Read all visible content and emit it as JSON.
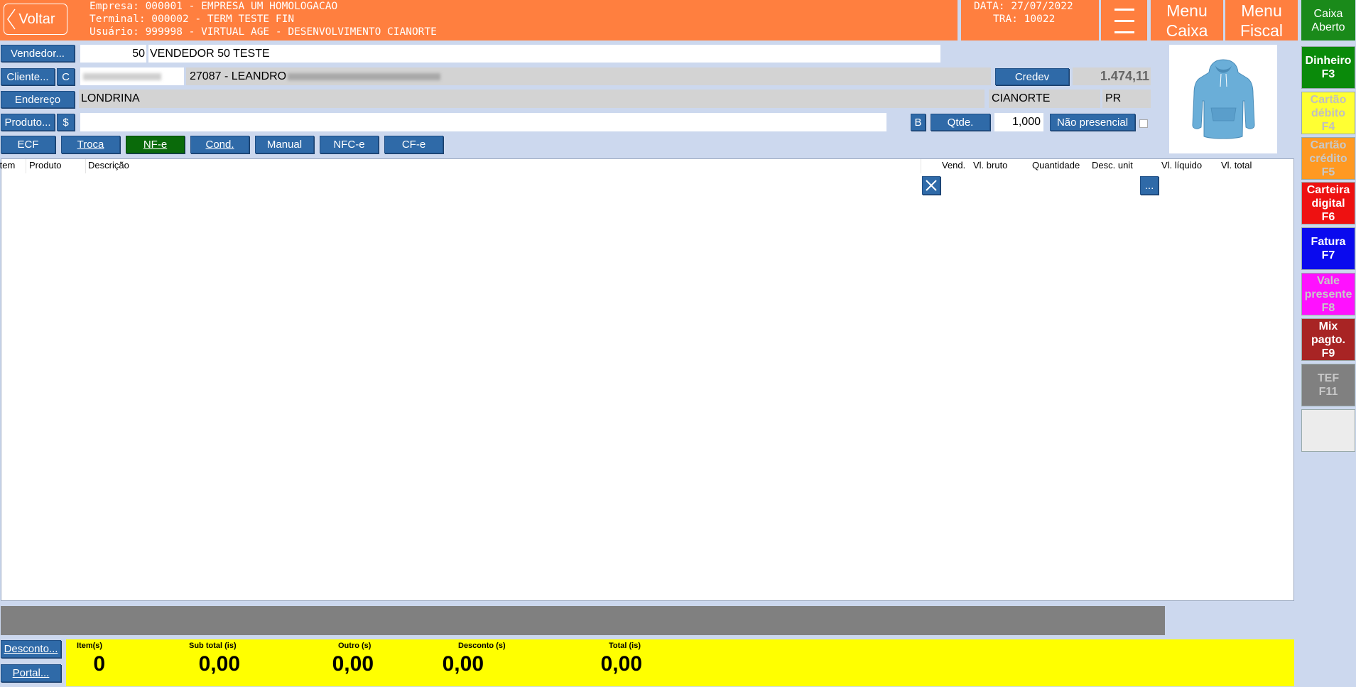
{
  "header": {
    "back_label": "Voltar",
    "empresa": "Empresa: 000001 - EMPRESA UM HOMOLOGACAO",
    "terminal": "Terminal: 000002 - TERM TESTE FIN",
    "usuario": "Usuário: 999998 - VIRTUAL AGE - DESENVOLVIMENTO CIANORTE",
    "data": "DATA: 27/07/2022",
    "tra": "TRA: 10022",
    "menu_caixa": [
      "Menu",
      "Caixa"
    ],
    "menu_fiscal": [
      "Menu",
      "Fiscal"
    ],
    "caixa_status": [
      "Caixa",
      "Aberto"
    ]
  },
  "form": {
    "vendedor_label": "Vendedor...",
    "vendedor_code": "50",
    "vendedor_name": "VENDEDOR 50 TESTE",
    "cliente_label": "Cliente...",
    "cliente_c_label": "C",
    "cliente_doc": "",
    "cliente_name": "27087 - LEANDRO",
    "credev_label": "Credev",
    "credev_value": "1.474,11",
    "endereco_label": "Endereço",
    "endereco_city": "LONDRINA",
    "endereco_city2": "CIANORTE",
    "endereco_uf": "PR",
    "produto_label": "Produto...",
    "produto_dollar_label": "$",
    "produto_value": "",
    "b_label": "B",
    "qtde_label": "Qtde.",
    "qtde_value": "1,000",
    "nao_presencial_label": "Não presencial"
  },
  "doc_types": [
    {
      "label": "ECF",
      "active": false
    },
    {
      "label": "Troca",
      "active": false
    },
    {
      "label": "NF-e",
      "active": true
    },
    {
      "label": "Cond.",
      "active": false
    },
    {
      "label": "Manual",
      "active": false
    },
    {
      "label": "NFC-e",
      "active": false
    },
    {
      "label": "CF-e",
      "active": false
    }
  ],
  "table": {
    "columns": [
      "Item",
      "Produto",
      "Descrição",
      "Vend.",
      "Vl. bruto",
      "Quantidade",
      "Desc. unit",
      "Vl. líquido",
      "Vl. total"
    ],
    "more_label": "...",
    "rows": []
  },
  "payments": [
    {
      "label": [
        "Dinheiro",
        "F3"
      ],
      "bg": "#0a8a0a",
      "fg": "#ffffff"
    },
    {
      "label": [
        "Cartão",
        "débito",
        "F4"
      ],
      "bg": "#ffff33",
      "fg": "#c0c0c0"
    },
    {
      "label": [
        "Cartão",
        "crédito",
        "F5"
      ],
      "bg": "#ff9922",
      "fg": "#c8c8c8"
    },
    {
      "label": [
        "Carteira",
        "digital",
        "F6"
      ],
      "bg": "#ee1111",
      "fg": "#ffffff"
    },
    {
      "label": [
        "Fatura",
        "F7"
      ],
      "bg": "#0a0aee",
      "fg": "#ffffff"
    },
    {
      "label": [
        "Vale",
        "presente",
        "F8"
      ],
      "bg": "#ff11ff",
      "fg": "#c8c8c8"
    },
    {
      "label": [
        "Mix",
        "pagto.",
        "F9"
      ],
      "bg": "#a82424",
      "fg": "#ffffff"
    },
    {
      "label": [
        "TEF",
        "F11"
      ],
      "bg": "#808080",
      "fg": "#c8c8c8"
    },
    {
      "label": [
        ""
      ],
      "bg": "#ececec",
      "fg": "#000000"
    }
  ],
  "footer": {
    "desconto_label": "Desconto...",
    "portal_label": "Portal...",
    "totals": [
      {
        "label": "Item(s)",
        "value": "0"
      },
      {
        "label": "Sub total (is)",
        "value": "0,00"
      },
      {
        "label": "Outro (s)",
        "value": "0,00"
      },
      {
        "label": "Desconto (s)",
        "value": "0,00"
      },
      {
        "label": "Total (is)",
        "value": "0,00"
      }
    ]
  },
  "colors": {
    "header_orange": "#ff7f3f",
    "button_blue": "#2f6aa8",
    "active_green": "#0a6a0a",
    "totals_yellow": "#ffff00",
    "caixa_green": "#1a8a1a"
  }
}
